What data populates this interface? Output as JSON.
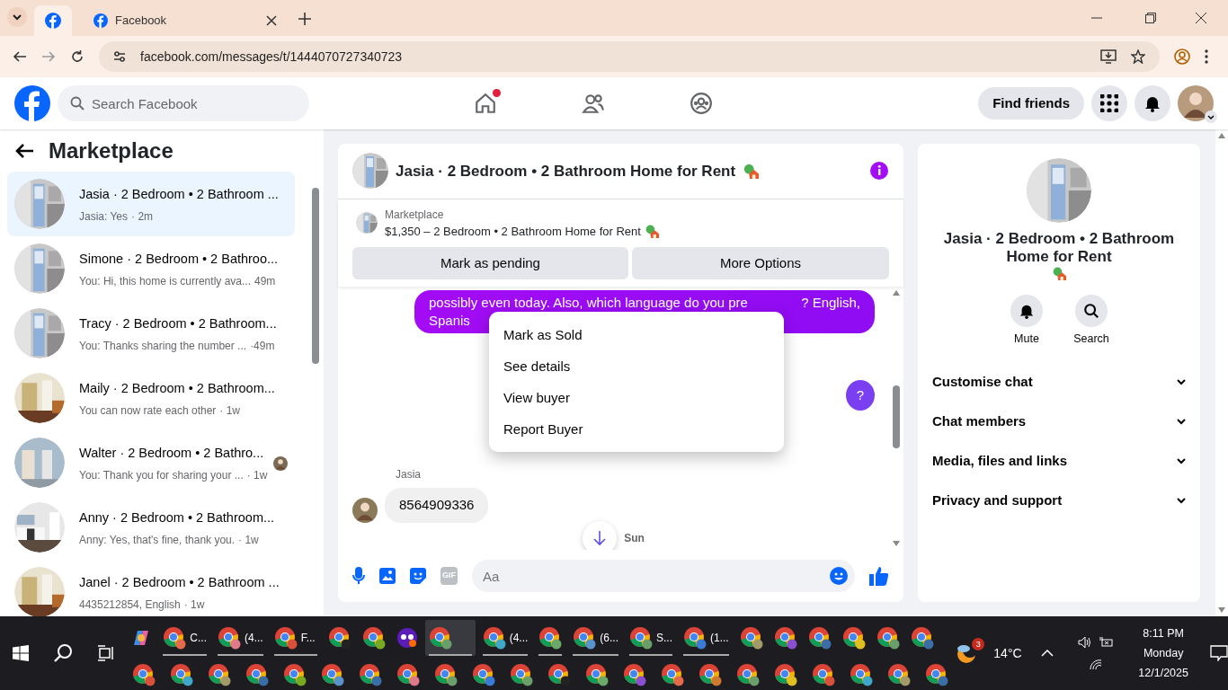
{
  "browser": {
    "tab_title": "Facebook",
    "url": "facebook.com/messages/t/1444070727340723"
  },
  "header": {
    "search_placeholder": "Search Facebook",
    "nav": [
      {
        "kind": "home",
        "notification": true
      },
      {
        "kind": "friends",
        "notification": false
      },
      {
        "kind": "groups",
        "notification": false
      }
    ],
    "find_friends": "Find friends"
  },
  "sidebar": {
    "title": "Marketplace",
    "conversations": [
      {
        "title": "Jasia · 2 Bedroom • 2 Bathroom ...",
        "preview": "Jasia: Yes",
        "time": "· 2m",
        "selected": true,
        "seen": false
      },
      {
        "title": "Simone · 2 Bedroom • 2 Bathroo...",
        "preview": "You: Hi, this home is currently ava...",
        "time": "49m",
        "selected": false,
        "seen": false
      },
      {
        "title": "Tracy · 2 Bedroom • 2 Bathroom...",
        "preview": "You: Thanks sharing the number ...",
        "time": "·49m",
        "selected": false,
        "seen": false
      },
      {
        "title": "Maily · 2 Bedroom • 2 Bathroom...",
        "preview": "You can now rate each other",
        "time": "· 1w",
        "selected": false,
        "seen": false
      },
      {
        "title": "Walter · 2 Bedroom • 2 Bathro...",
        "preview": "You: Thank you for sharing your ...",
        "time": "· 1w",
        "selected": false,
        "seen": true
      },
      {
        "title": "Anny · 2 Bedroom • 2 Bathroom...",
        "preview": "Anny: Yes, that's fine, thank you.",
        "time": "· 1w",
        "selected": false,
        "seen": false
      },
      {
        "title": "Janel · 2 Bedroom • 2 Bathroom ...",
        "preview": "4435212854, English",
        "time": "· 1w",
        "selected": false,
        "seen": false
      }
    ]
  },
  "chat": {
    "title": "Jasia · 2 Bedroom • 2 Bathroom Home for Rent",
    "listing": {
      "source": "Marketplace",
      "line": "$1,350 – 2 Bedroom • 2 Bathroom Home for Rent"
    },
    "buttons": [
      "Mark as pending",
      "More Options"
    ],
    "menu": [
      "Mark as Sold",
      "See details",
      "View buyer",
      "Report Buyer"
    ],
    "messages": [
      {
        "kind": "outgoing",
        "parts": [
          "possibly even today. Also, which language do you pre",
          "? English,",
          "Spanis"
        ]
      },
      {
        "kind": "outgoing_small",
        "text": "?"
      },
      {
        "kind": "incoming",
        "sender": "Jasia",
        "text": "8564909336"
      }
    ],
    "timestamp": "Sun",
    "composer": {
      "placeholder": "Aa",
      "gif_label": "GIF"
    }
  },
  "details": {
    "title": "Jasia · 2 Bedroom • 2 Bathroom Home for Rent",
    "actions": [
      {
        "kind": "bell",
        "label": "Mute"
      },
      {
        "kind": "search",
        "label": "Search"
      }
    ],
    "sections": [
      {
        "label": "Customise chat",
        "expanded": false
      },
      {
        "label": "Chat members",
        "expanded": false
      },
      {
        "label": "Media, files and links",
        "expanded": false
      },
      {
        "label": "Privacy and support",
        "expanded": false
      }
    ]
  },
  "taskbar": {
    "apps": [
      {
        "kind": "copilot",
        "open": false,
        "selected": false
      },
      {
        "kind": "browser",
        "label": "C...",
        "open": true,
        "selected": false
      },
      {
        "kind": "browser",
        "label": "(4...",
        "open": true,
        "selected": false
      },
      {
        "kind": "browser",
        "label": "F...",
        "open": true,
        "selected": false
      },
      {
        "kind": "browser",
        "open": false,
        "selected": false
      },
      {
        "kind": "browser",
        "open": false,
        "selected": false
      },
      {
        "kind": "mask",
        "open": false,
        "selected": false
      },
      {
        "kind": "browser",
        "open": true,
        "selected": true
      },
      {
        "kind": "browser",
        "label": "(4...",
        "open": true,
        "selected": false
      },
      {
        "kind": "browser",
        "open": true,
        "selected": false
      },
      {
        "kind": "browser",
        "label": "(6...",
        "open": true,
        "selected": false
      },
      {
        "kind": "browser",
        "label": "S...",
        "open": true,
        "selected": false
      },
      {
        "kind": "browser",
        "label": "(1...",
        "open": true,
        "selected": false
      },
      {
        "kind": "browser",
        "open": false,
        "selected": false
      },
      {
        "kind": "browser",
        "open": false,
        "selected": false
      },
      {
        "kind": "browser",
        "open": false,
        "selected": false
      },
      {
        "kind": "browser",
        "open": false,
        "selected": false
      },
      {
        "kind": "browser",
        "open": false,
        "selected": false
      },
      {
        "kind": "browser",
        "open": false,
        "selected": false
      }
    ],
    "weather": {
      "temp": "14°C",
      "badge": "3"
    },
    "clock": {
      "time": "8:11 PM",
      "day": "Monday",
      "date": "12/1/2025"
    }
  }
}
